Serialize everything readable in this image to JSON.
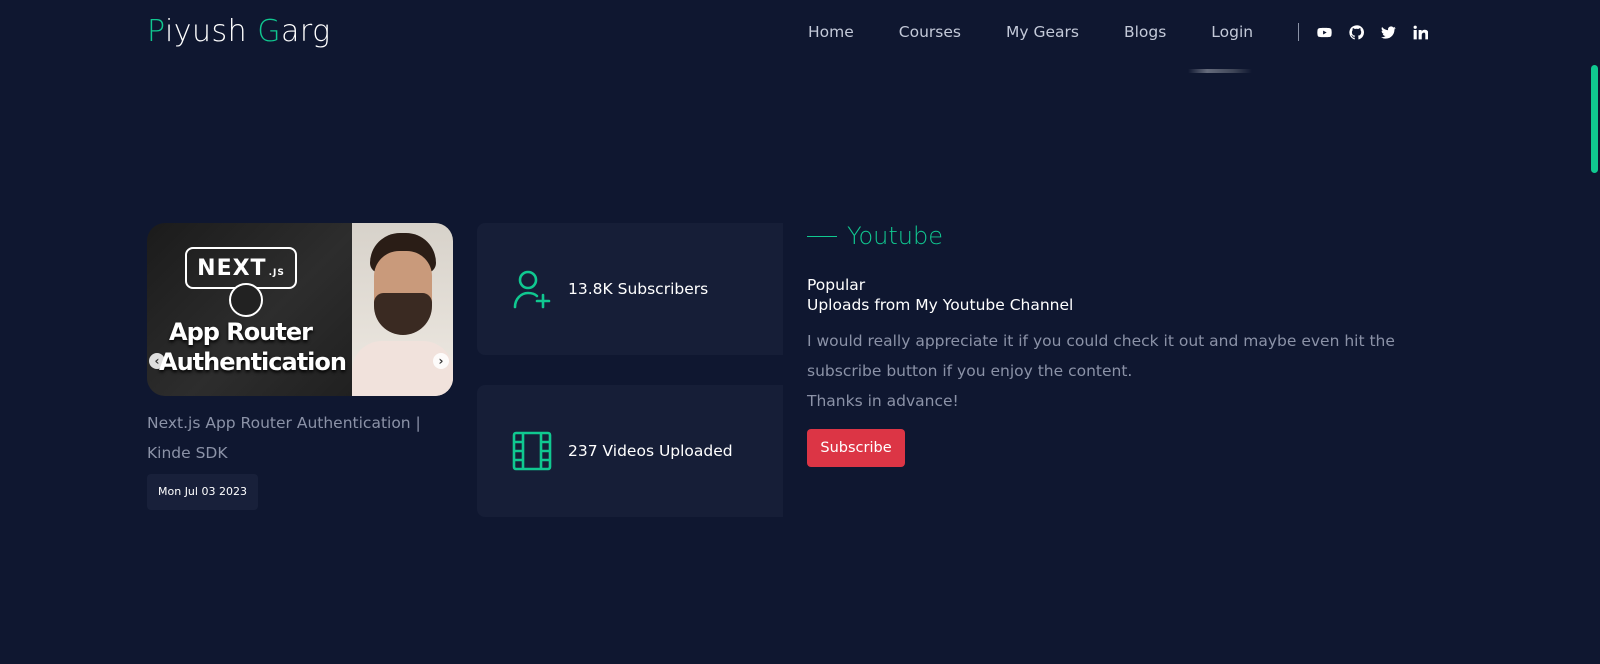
{
  "header": {
    "logo_part1": "Piyush",
    "logo_part2": "Garg",
    "nav": [
      "Home",
      "Courses",
      "My Gears",
      "Blogs",
      "Login"
    ],
    "social_icons": [
      "youtube-icon",
      "github-icon",
      "twitter-icon",
      "linkedin-icon"
    ]
  },
  "video": {
    "thumbnail_logo": "NEXT",
    "thumbnail_logo_suffix": ".JS",
    "thumbnail_line1": "App Router",
    "thumbnail_line2": "Authentication",
    "prev_arrow": "‹",
    "next_arrow": "›",
    "title": "Next.js App Router Authentication | Kinde SDK",
    "date": "Mon Jul 03 2023"
  },
  "stats": {
    "subscribers": "13.8K Subscribers",
    "videos": "237 Videos Uploaded"
  },
  "youtube": {
    "heading": "Youtube",
    "sub_line1": "Popular",
    "sub_line2": "Uploads from My Youtube Channel",
    "description": "I would really appreciate it if you could check it out and maybe even hit the subscribe button if you enjoy the content.",
    "thanks": "Thanks in advance!",
    "subscribe_label": "Subscribe"
  },
  "colors": {
    "background": "#0f1730",
    "card": "#161e37",
    "accent": "#10c890",
    "button": "#dc3545",
    "muted_text": "#8b92a7"
  }
}
